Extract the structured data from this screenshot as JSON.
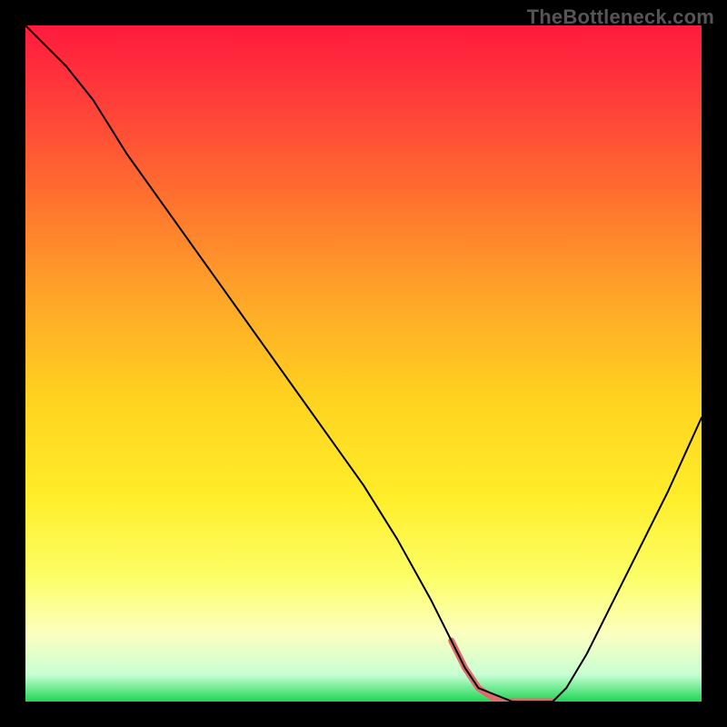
{
  "watermark": "TheBottleneck.com",
  "chart_data": {
    "type": "line",
    "title": "",
    "xlabel": "",
    "ylabel": "",
    "xlim": [
      0,
      100
    ],
    "ylim": [
      0,
      100
    ],
    "background_gradient": {
      "stops": [
        {
          "offset": 0,
          "color": "#ff1a3e"
        },
        {
          "offset": 10,
          "color": "#ff3a3a"
        },
        {
          "offset": 25,
          "color": "#ff6f2f"
        },
        {
          "offset": 40,
          "color": "#ffa529"
        },
        {
          "offset": 55,
          "color": "#ffd21f"
        },
        {
          "offset": 70,
          "color": "#ffee2a"
        },
        {
          "offset": 82,
          "color": "#fcff6a"
        },
        {
          "offset": 90,
          "color": "#fcffc0"
        },
        {
          "offset": 96,
          "color": "#c8ffd4"
        },
        {
          "offset": 100,
          "color": "#1fd655"
        }
      ]
    },
    "series": [
      {
        "name": "bottleneck-curve",
        "stroke": "#000000",
        "stroke_width": 2,
        "x": [
          0,
          3,
          6,
          10,
          15,
          20,
          25,
          30,
          35,
          40,
          45,
          50,
          55,
          60,
          63,
          65,
          67,
          72,
          76,
          78,
          80,
          83,
          86,
          90,
          95,
          100
        ],
        "y": [
          100,
          97,
          94,
          89,
          81,
          74,
          67,
          60,
          53,
          46,
          39,
          32,
          24,
          15,
          9,
          5,
          2,
          0,
          0,
          0,
          2,
          7,
          13,
          21,
          31,
          42
        ]
      }
    ],
    "highlight": {
      "name": "optimal-range",
      "stroke": "#e16a6a",
      "stroke_width": 7,
      "x": [
        63,
        65,
        67,
        70,
        72,
        74,
        76,
        78
      ],
      "y": [
        9,
        5,
        2,
        0,
        0,
        0,
        0,
        0
      ]
    }
  }
}
